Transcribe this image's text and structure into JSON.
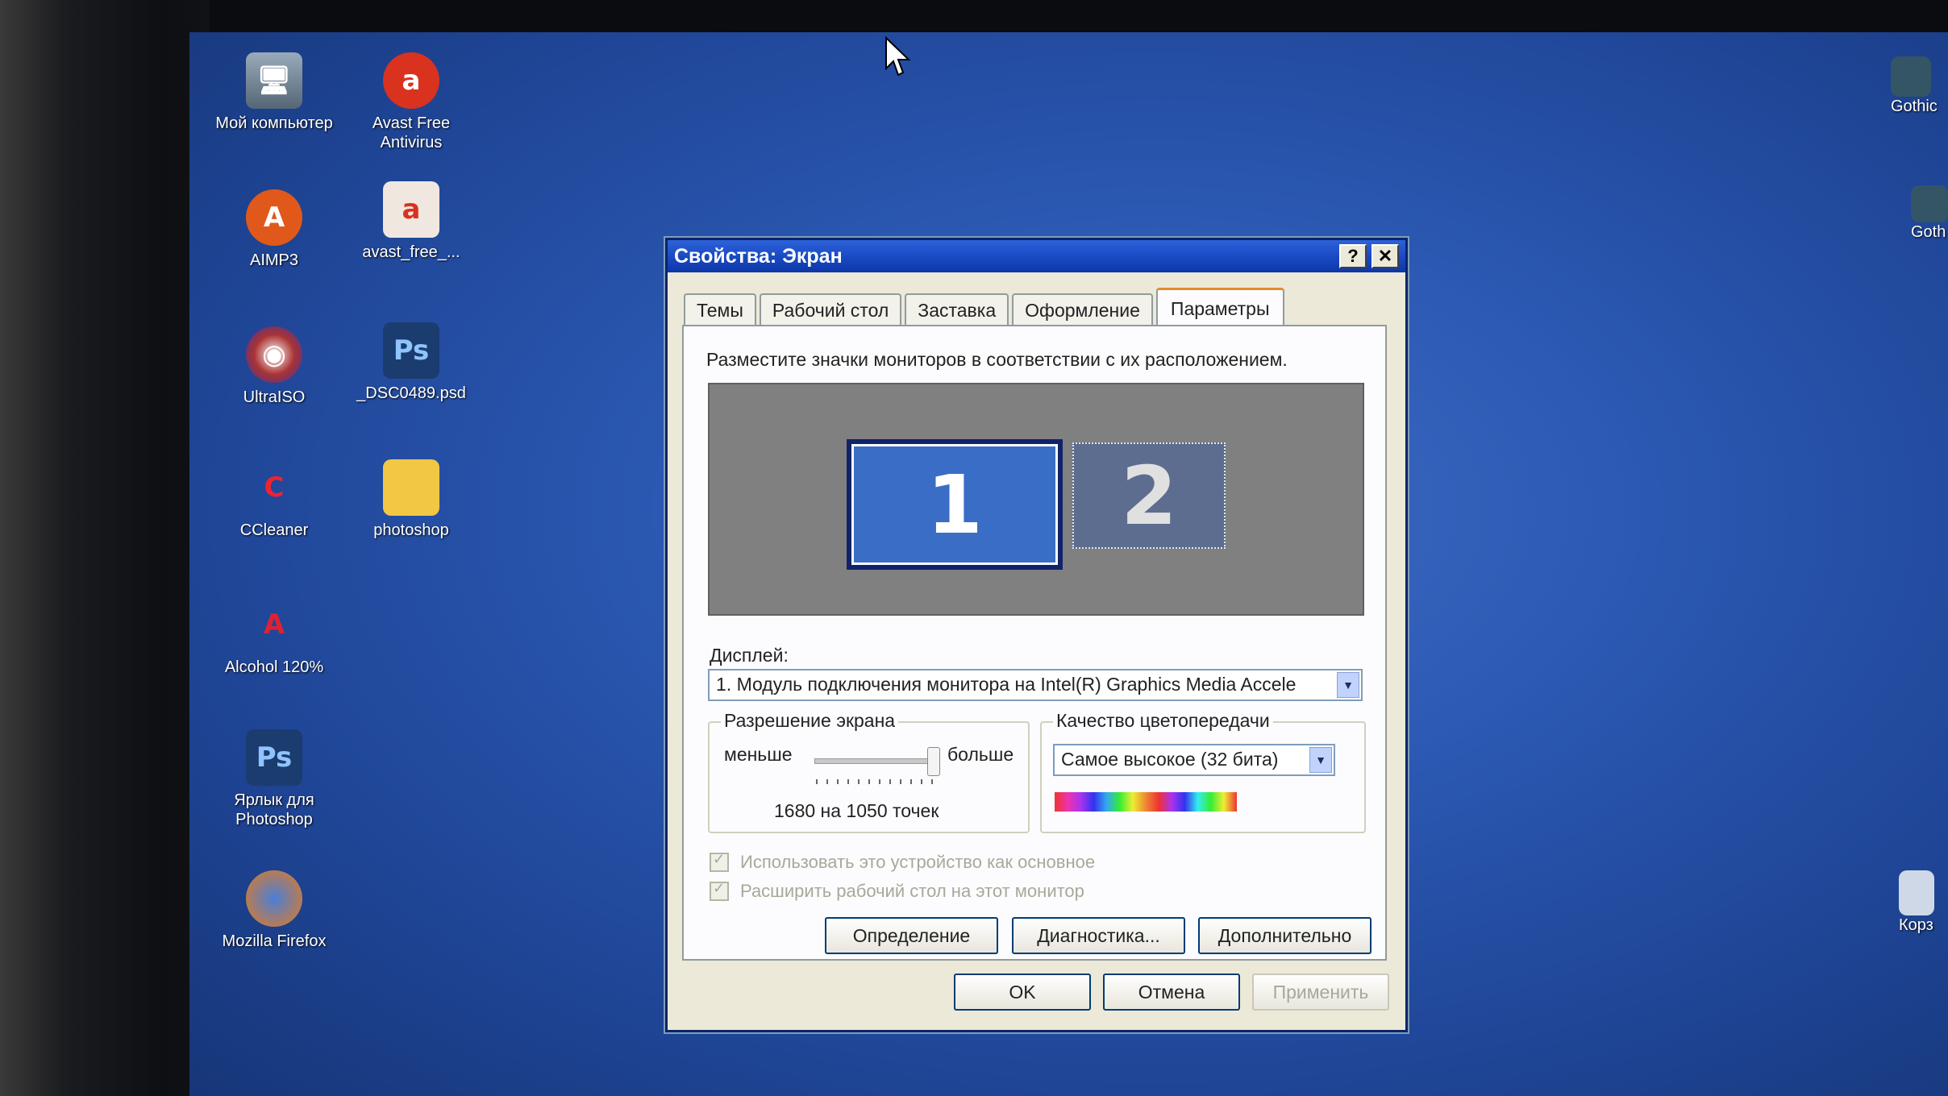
{
  "desktop": {
    "icons": [
      {
        "label": "Мой компьютер"
      },
      {
        "label": "Avast Free Antivirus"
      },
      {
        "label": "AIMP3"
      },
      {
        "label": "avast_free_..."
      },
      {
        "label": "UltraISO"
      },
      {
        "label": "_DSC0489.psd"
      },
      {
        "label": "CCleaner"
      },
      {
        "label": "photoshop"
      },
      {
        "label": "Alcohol 120%"
      },
      {
        "label": "Ярлык для Photoshop"
      },
      {
        "label": "Mozilla Firefox"
      },
      {
        "label": "Gothic"
      },
      {
        "label": "Goth"
      },
      {
        "label": "Корз"
      }
    ]
  },
  "dialog": {
    "title": "Свойства: Экран",
    "help_label": "?",
    "close_label": "✕",
    "tabs": [
      {
        "label": "Темы"
      },
      {
        "label": "Рабочий стол"
      },
      {
        "label": "Заставка"
      },
      {
        "label": "Оформление"
      },
      {
        "label": "Параметры"
      }
    ],
    "instruction": "Разместите значки мониторов в соответствии с их расположением.",
    "monitors": [
      {
        "label": "1"
      },
      {
        "label": "2"
      }
    ],
    "display_label": "Дисплей:",
    "display_value": "1. Модуль подключения монитора на Intel(R) Graphics Media Accele",
    "resolution": {
      "title": "Разрешение экрана",
      "less": "меньше",
      "more": "больше",
      "value_text": "1680 на 1050 точек"
    },
    "color": {
      "title": "Качество цветопередачи",
      "value": "Самое высокое (32 бита)"
    },
    "checkbox_primary": "Использовать это устройство как основное",
    "checkbox_extend": "Расширить рабочий стол на этот монитор",
    "buttons": {
      "identify": "Определение",
      "troubleshoot": "Диагностика...",
      "advanced": "Дополнительно",
      "ok": "OK",
      "cancel": "Отмена",
      "apply": "Применить"
    }
  }
}
